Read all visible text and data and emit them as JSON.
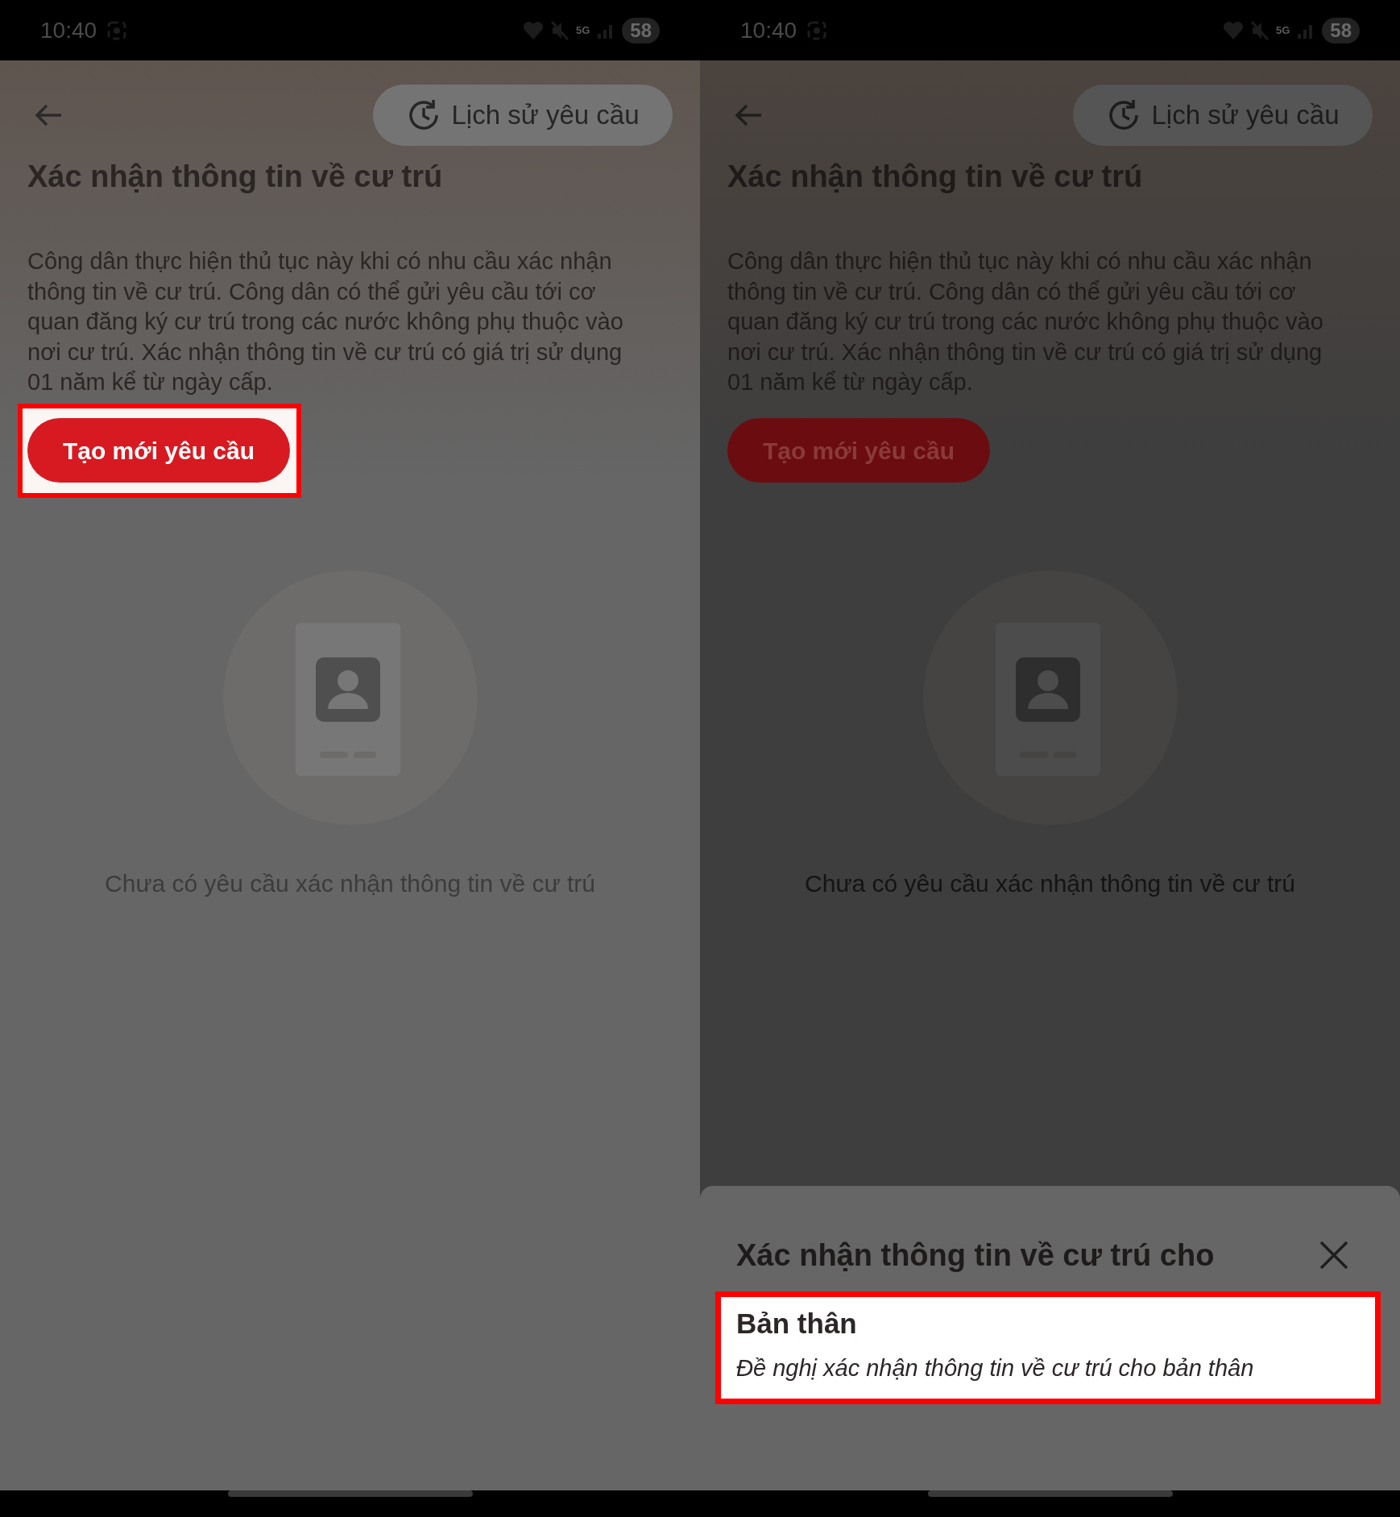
{
  "screens": [
    {
      "status_bar": {
        "time": "10:40",
        "network": "5G",
        "battery": "58"
      },
      "history_button": {
        "label": "Lịch sử yêu cầu"
      },
      "title": "Xác nhận thông tin về cư trú",
      "description": "Công dân thực hiện thủ tục này khi có nhu cầu xác nhận thông tin về cư trú. Công dân có thể gửi yêu cầu tới cơ quan đăng ký cư trú trong các nước không phụ thuộc vào nơi cư trú. Xác nhận thông tin về cư trú có giá trị sử dụng 01 năm kể từ ngày cấp.",
      "create_button": {
        "label": "Tạo mới yêu cầu",
        "highlighted": true
      },
      "empty_state": {
        "text": "Chưa có yêu cầu xác nhận thông tin về cư trú"
      }
    },
    {
      "status_bar": {
        "time": "10:40",
        "network": "5G",
        "battery": "58"
      },
      "history_button": {
        "label": "Lịch sử yêu cầu"
      },
      "title": "Xác nhận thông tin về cư trú",
      "description": "Công dân thực hiện thủ tục này khi có nhu cầu xác nhận thông tin về cư trú. Công dân có thể gửi yêu cầu tới cơ quan đăng ký cư trú trong các nước không phụ thuộc vào nơi cư trú. Xác nhận thông tin về cư trú có giá trị sử dụng 01 năm kể từ ngày cấp.",
      "create_button": {
        "label": "Tạo mới yêu cầu",
        "highlighted": false
      },
      "empty_state": {
        "text": "Chưa có yêu cầu xác nhận thông tin về cư trú"
      },
      "sheet": {
        "title": "Xác nhận thông tin về cư trú cho",
        "options": [
          {
            "title": "Bản thân",
            "description": "Đề nghị xác nhận thông tin về cư trú cho bản thân",
            "highlighted": true
          }
        ]
      }
    }
  ]
}
